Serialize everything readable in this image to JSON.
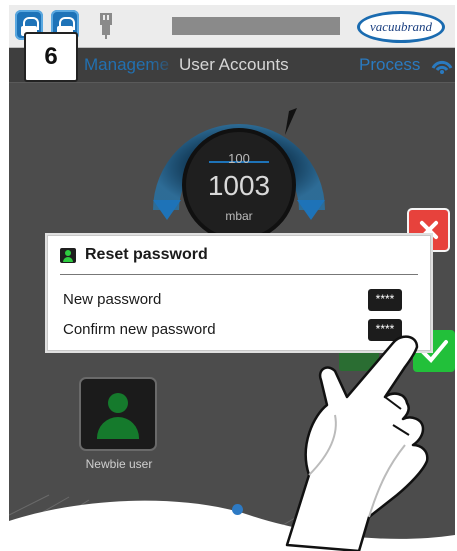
{
  "header": {
    "logo_text": "vacuubrand",
    "step_number": "6",
    "colors": {
      "accent": "#1e73b8",
      "background": "#4c4c4c"
    }
  },
  "nav": {
    "left_tab": "Manageme",
    "title": "User Accounts",
    "right_tab": "Process"
  },
  "gauge": {
    "setpoint": "100",
    "value": "1003",
    "unit": "mbar"
  },
  "dialog": {
    "title": "Reset password",
    "rows": [
      {
        "label": "New password",
        "value": "****"
      },
      {
        "label": "Confirm new password",
        "value": "****"
      }
    ]
  },
  "users": [
    {
      "label": "Newbie user"
    }
  ],
  "icons": [
    "lock-icon",
    "plug-icon",
    "user-icon",
    "close-icon",
    "check-icon",
    "wifi-icon"
  ]
}
